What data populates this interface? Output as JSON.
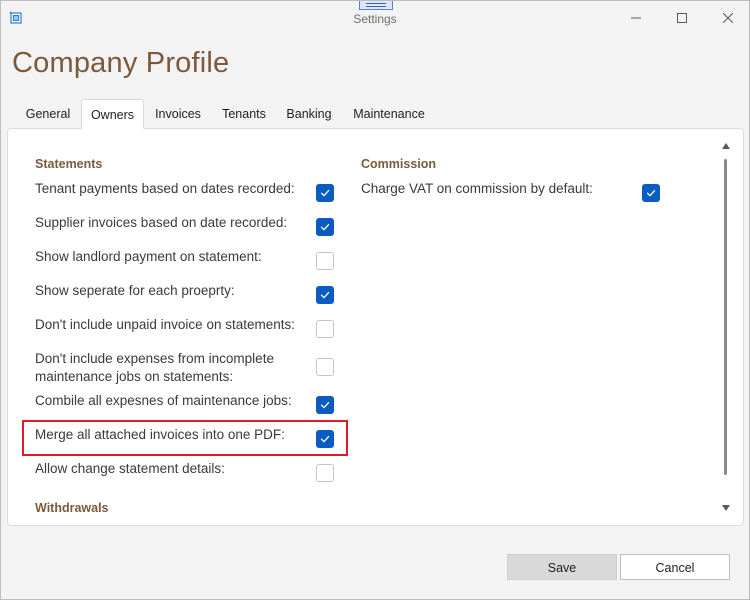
{
  "window": {
    "title": "Settings"
  },
  "page": {
    "title": "Company Profile"
  },
  "tabs": [
    {
      "label": "General"
    },
    {
      "label": "Owners"
    },
    {
      "label": "Invoices"
    },
    {
      "label": "Tenants"
    },
    {
      "label": "Banking"
    },
    {
      "label": "Maintenance"
    }
  ],
  "active_tab": "Owners",
  "statements": {
    "heading": "Statements",
    "options": [
      {
        "label": "Tenant payments based on dates recorded:",
        "checked": true
      },
      {
        "label": "Supplier invoices based on date recorded:",
        "checked": true
      },
      {
        "label": "Show landlord payment on statement:",
        "checked": false
      },
      {
        "label": "Show seperate for each proeprty:",
        "checked": true
      },
      {
        "label": "Don't include unpaid invoice on statements:",
        "checked": false
      },
      {
        "label_line1": "Don't include expenses from incomplete",
        "label_line2": "maintenance jobs on statements:",
        "checked": false
      },
      {
        "label": "Combile all expesnes of maintenance jobs:",
        "checked": true
      },
      {
        "label": "Merge all attached invoices into one PDF:",
        "checked": true
      },
      {
        "label": "Allow change statement details:",
        "checked": false
      }
    ]
  },
  "withdrawals": {
    "heading": "Withdrawals"
  },
  "commission": {
    "heading": "Commission",
    "options": [
      {
        "label": "Charge VAT on commission by default:",
        "checked": true
      }
    ]
  },
  "footer": {
    "save_label": "Save",
    "cancel_label": "Cancel"
  },
  "colors": {
    "accent": "#0b5cc2",
    "heading": "#7a5a3c",
    "highlight": "#e01b24"
  }
}
